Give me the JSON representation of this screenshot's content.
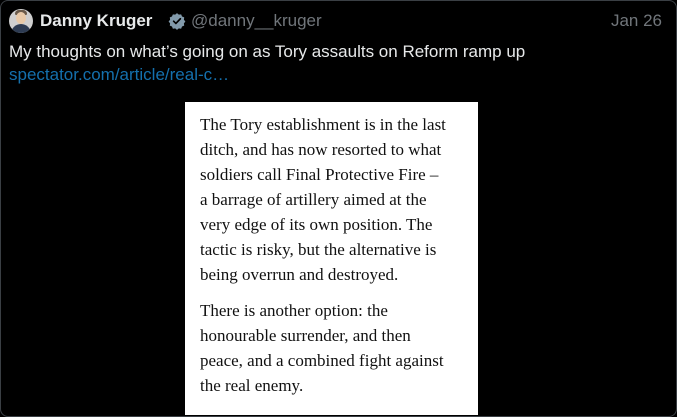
{
  "tweet": {
    "author_name": "Danny Kruger",
    "handle": "@danny__kruger",
    "date": "Jan 26",
    "text": "My thoughts on what’s going on as Tory assaults on Reform ramp up",
    "link_text": "spectator.com/article/real-c…"
  },
  "quote": {
    "paragraph1_lines": [
      "The Tory establishment is in the last",
      "ditch, and has now resorted to what",
      "soldiers call Final Protective Fire –",
      "a barrage of artillery aimed at the",
      "very edge of its own position. The",
      "tactic is risky, but the alternative is",
      "being overrun and destroyed."
    ],
    "paragraph2_lines": [
      "There is another option: the",
      "honourable surrender, and then",
      "peace, and a combined fight against",
      "the real enemy."
    ]
  },
  "icons": {
    "avatar": "avatar",
    "verified": "verified-badge-icon"
  },
  "colors": {
    "background": "#000000",
    "text_primary": "#e7e9ea",
    "text_secondary": "#71767b",
    "link": "#1d9bf0",
    "verified_badge": "#829aab"
  }
}
